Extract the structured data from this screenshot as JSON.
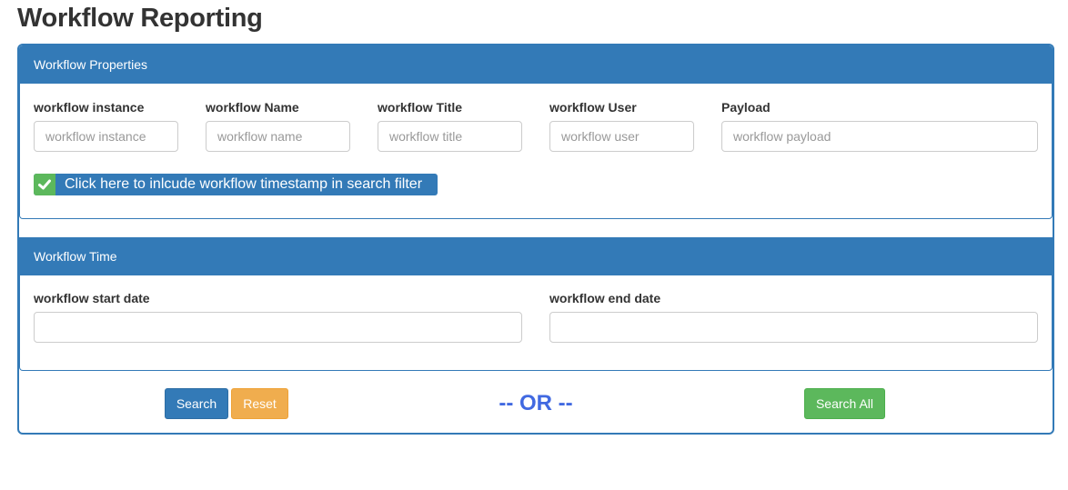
{
  "page": {
    "title": "Workflow Reporting"
  },
  "properties_panel": {
    "heading": "Workflow Properties",
    "fields": [
      {
        "label": "workflow instance",
        "placeholder": "workflow instance"
      },
      {
        "label": "workflow Name",
        "placeholder": "workflow name"
      },
      {
        "label": "workflow Title",
        "placeholder": "workflow title"
      },
      {
        "label": "workflow User",
        "placeholder": "workflow user"
      },
      {
        "label": "Payload",
        "placeholder": "workflow payload"
      }
    ],
    "timestamp_toggle": {
      "checked": true,
      "label": "Click here to inlcude workflow timestamp in search filter",
      "check_icon": "check-icon"
    }
  },
  "time_panel": {
    "heading": "Workflow Time",
    "start_label": "workflow start date",
    "start_value": "",
    "end_label": "workflow end date",
    "end_value": ""
  },
  "actions": {
    "search_label": "Search",
    "reset_label": "Reset",
    "or_text": "-- OR --",
    "search_all_label": "Search All"
  },
  "colors": {
    "primary": "#337ab7",
    "success": "#5cb85c",
    "warning": "#f0ad4e",
    "or_text": "#4169e1"
  }
}
